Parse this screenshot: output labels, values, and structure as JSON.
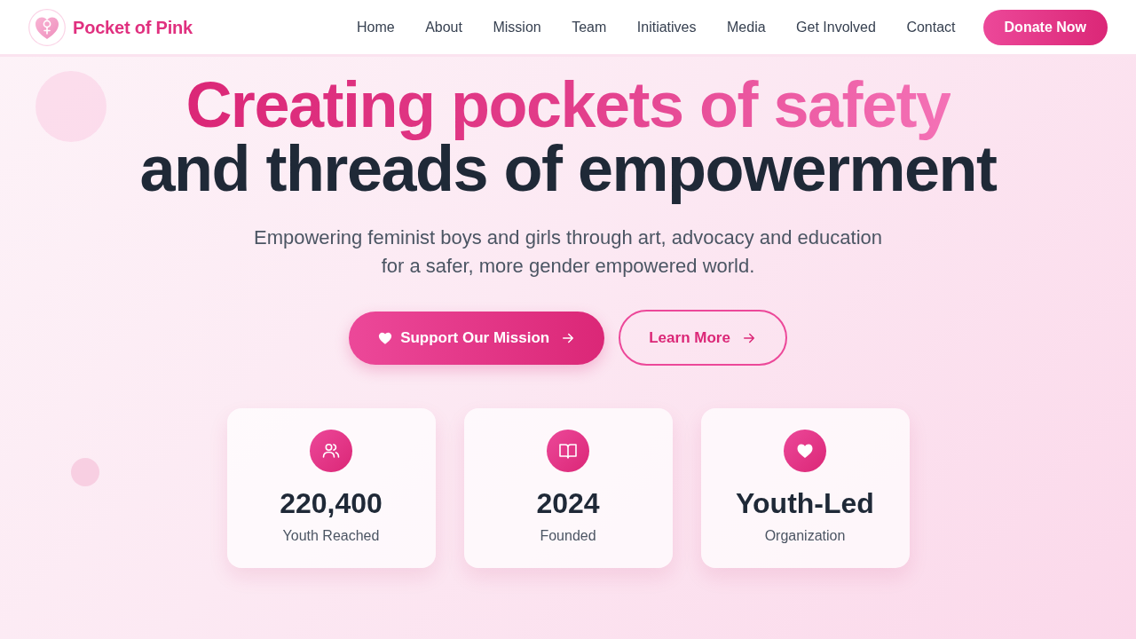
{
  "navbar": {
    "brand": "Pocket of Pink",
    "links": [
      "Home",
      "About",
      "Mission",
      "Team",
      "Initiatives",
      "Media",
      "Get Involved",
      "Contact"
    ],
    "cta": "Donate Now"
  },
  "hero": {
    "title_highlight": "Creating pockets of safety",
    "title_rest": "and threads of empowerment",
    "subtitle": "Empowering feminist boys and girls through art, advocacy and education for a safer, more gender empowered world.",
    "buttons": [
      {
        "label": "Support Our Mission",
        "kind": "primary"
      },
      {
        "label": "Learn More",
        "kind": "outline"
      }
    ]
  },
  "stats": [
    {
      "value": "220,400",
      "label": "Youth Reached"
    },
    {
      "value": "2024",
      "label": "Founded"
    },
    {
      "value": "Youth-Led",
      "label": "Organization"
    }
  ]
}
